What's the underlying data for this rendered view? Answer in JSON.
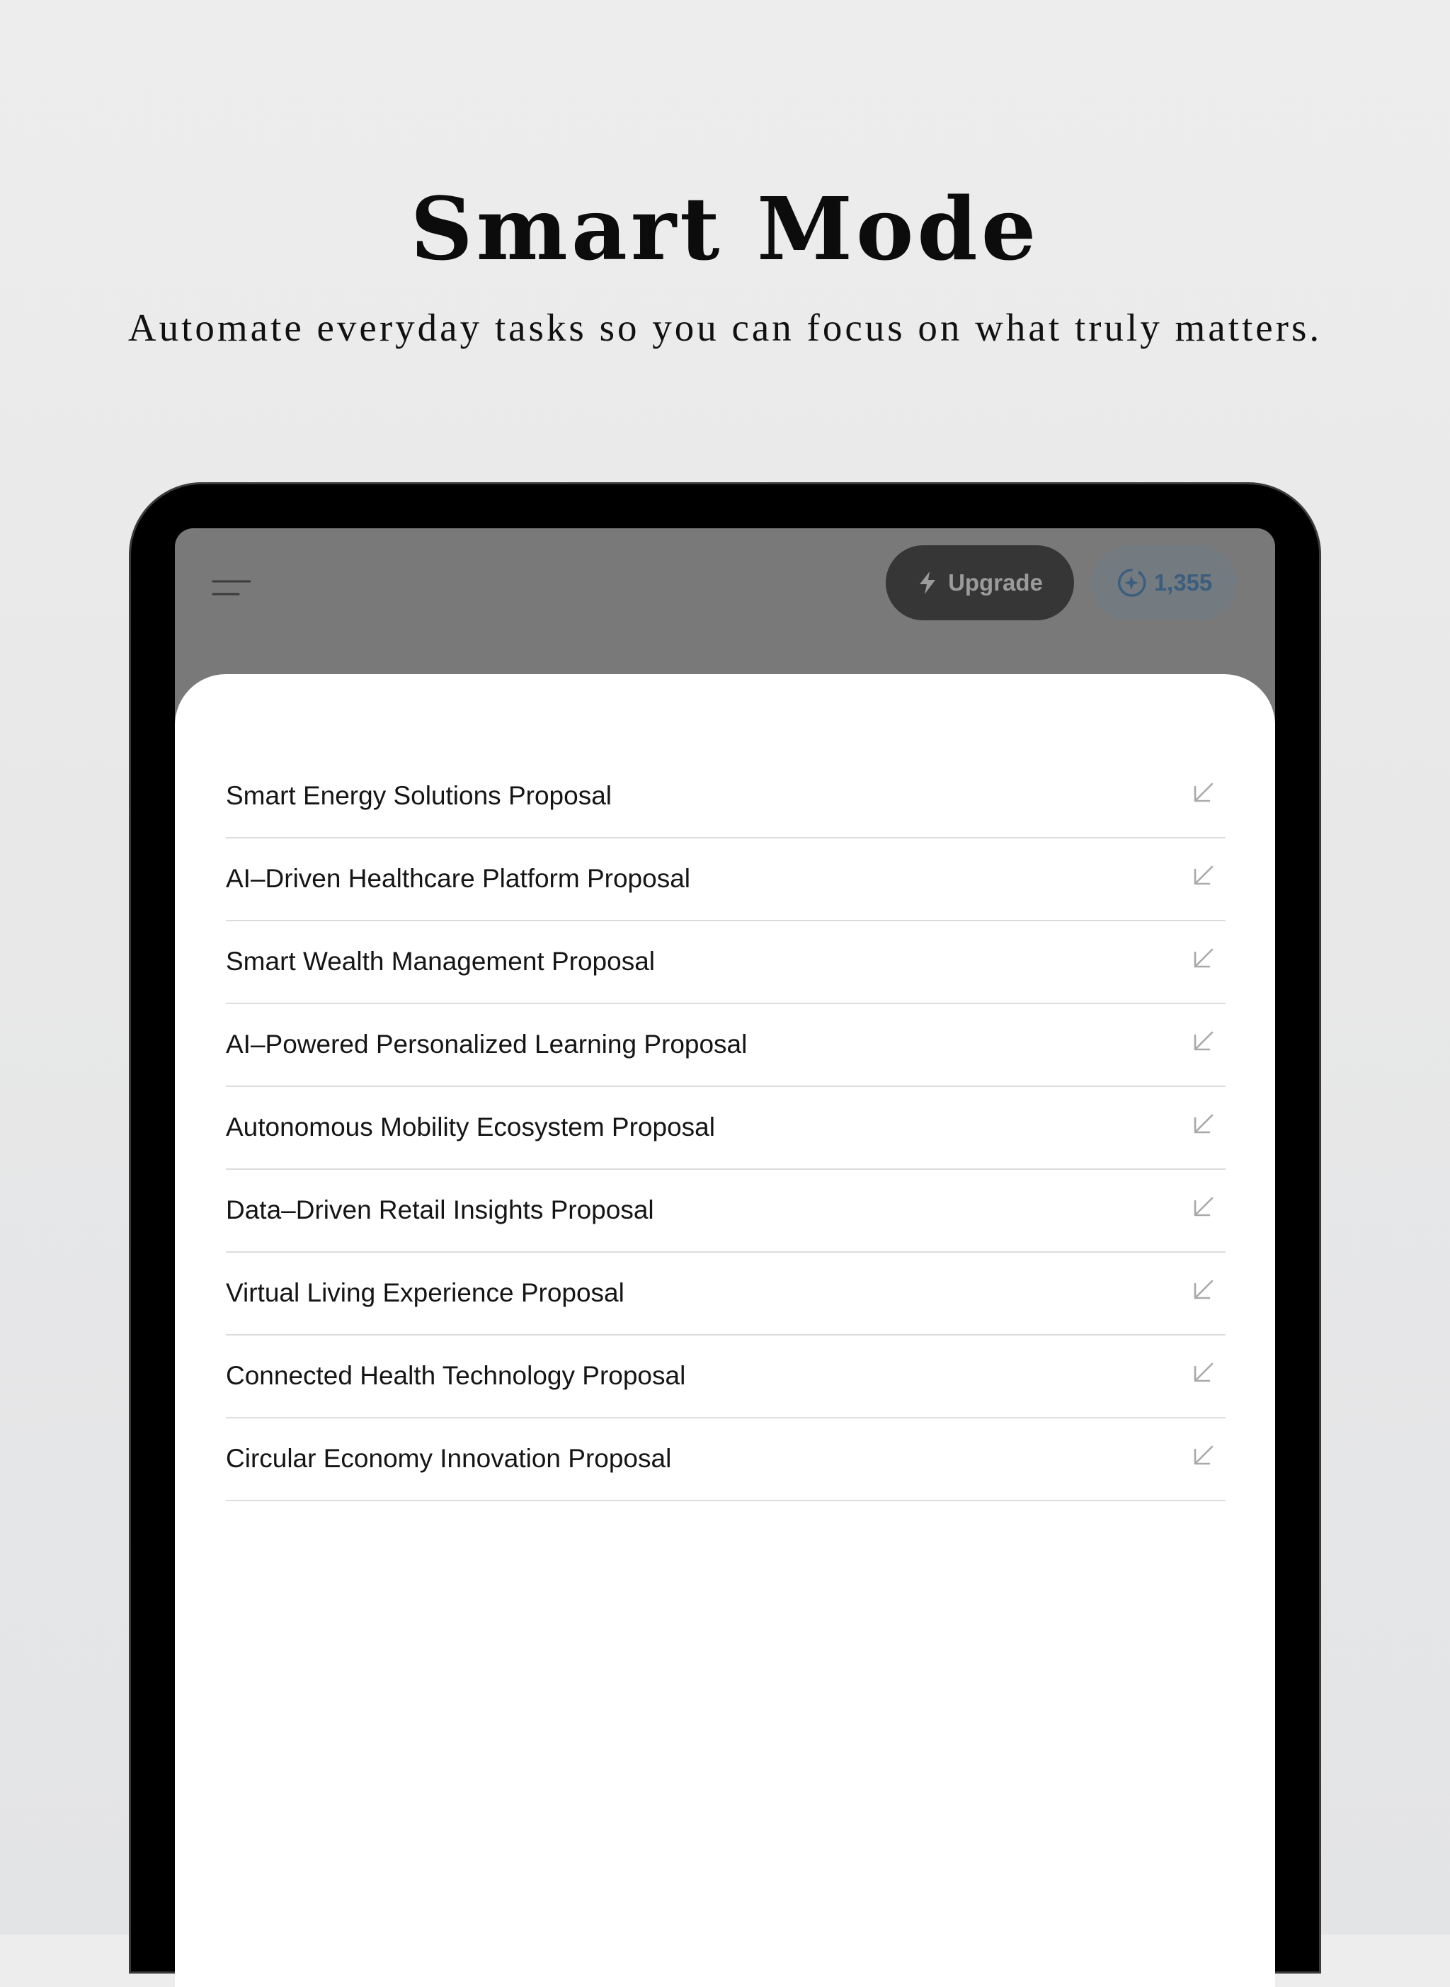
{
  "promo": {
    "title": "Smart Mode",
    "subtitle": "Automate everyday tasks so you can focus on what truly matters."
  },
  "header": {
    "menu_icon": "menu-icon",
    "upgrade_label": "Upgrade",
    "upgrade_icon": "lightning-icon",
    "credits_value": "1,355",
    "credits_icon": "sparkle-circle-icon"
  },
  "proposals": [
    {
      "label": "Smart Energy Solutions Proposal",
      "icon": "arrow-down-left-icon"
    },
    {
      "label": "AI–Driven Healthcare Platform Proposal",
      "icon": "arrow-down-left-icon"
    },
    {
      "label": "Smart Wealth Management Proposal",
      "icon": "arrow-down-left-icon"
    },
    {
      "label": "AI–Powered Personalized Learning Proposal",
      "icon": "arrow-down-left-icon"
    },
    {
      "label": "Autonomous Mobility Ecosystem Proposal",
      "icon": "arrow-down-left-icon"
    },
    {
      "label": "Data–Driven Retail Insights Proposal",
      "icon": "arrow-down-left-icon"
    },
    {
      "label": "Virtual Living Experience Proposal",
      "icon": "arrow-down-left-icon"
    },
    {
      "label": "Connected Health Technology Proposal",
      "icon": "arrow-down-left-icon"
    },
    {
      "label": "Circular Economy Innovation Proposal",
      "icon": "arrow-down-left-icon"
    }
  ],
  "colors": {
    "backdrop": "#e9e9e9",
    "dim_overlay": "#7a7979",
    "upgrade_bg": "#363636",
    "credits_accent": "#3c5e7e"
  }
}
